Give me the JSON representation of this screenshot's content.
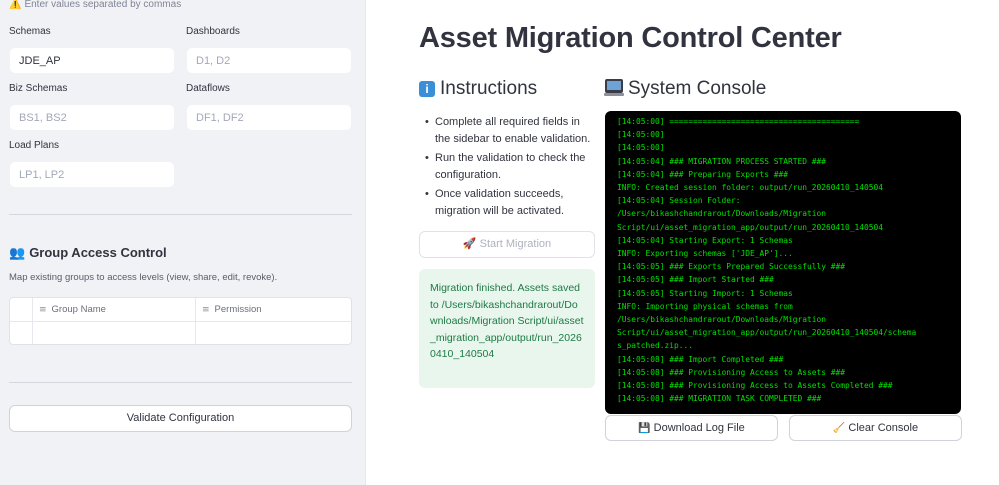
{
  "sidebar": {
    "hint": "Enter values separated by commas",
    "fields": {
      "schemas": {
        "label": "Schemas",
        "value": "JDE_AP",
        "placeholder": ""
      },
      "dashboards": {
        "label": "Dashboards",
        "value": "",
        "placeholder": "D1, D2"
      },
      "biz_schemas": {
        "label": "Biz Schemas",
        "value": "",
        "placeholder": "BS1, BS2"
      },
      "dataflows": {
        "label": "Dataflows",
        "value": "",
        "placeholder": "DF1, DF2"
      },
      "load_plans": {
        "label": "Load Plans",
        "value": "",
        "placeholder": "LP1, LP2"
      }
    },
    "group_access": {
      "title": "Group Access Control",
      "subtitle": "Map existing groups to access levels (view, share, edit, revoke).",
      "columns": [
        "Group Name",
        "Permission"
      ]
    },
    "validate_button": "Validate Configuration"
  },
  "main": {
    "title": "Asset Migration Control Center",
    "instructions": {
      "heading": "Instructions",
      "steps": [
        "Complete all required fields in the sidebar to enable validation.",
        "Run the validation to check the configuration.",
        "Once validation succeeds, migration will be activated."
      ]
    },
    "start_button": "Start Migration",
    "success_message": "Migration finished. Assets saved to /Users/bikashchandrarout/Downloads/Migration Script/ui/asset_migration_app/output/run_20260410_140504",
    "console": {
      "heading": "System Console",
      "lines": [
        "[14:05:00] ========================================",
        "[14:05:00]",
        "[14:05:00]",
        "[14:05:04] ### MIGRATION PROCESS STARTED ###",
        "[14:05:04] ### Preparing Exports ###",
        "INFO: Created session folder: output/run_20260410_140504",
        "[14:05:04] Session Folder:",
        "/Users/bikashchandrarout/Downloads/Migration",
        "Script/ui/asset_migration_app/output/run_20260410_140504",
        "[14:05:04] Starting Export: 1 Schemas",
        "INFO: Exporting schemas ['JDE_AP']...",
        "[14:05:05] ### Exports Prepared Successfully ###",
        "[14:05:05] ### Import Started ###",
        "[14:05:05] Starting Import: 1 Schemas",
        "INFO: Importing physical schemas from",
        "/Users/bikashchandrarout/Downloads/Migration",
        "Script/ui/asset_migration_app/output/run_20260410_140504/schema",
        "s_patched.zip...",
        "[14:05:08] ### Import Completed ###",
        "[14:05:08] ### Provisioning Access to Assets ###",
        "[14:05:08] ### Provisioning Access to Assets Completed ###",
        "[14:05:08] ### MIGRATION TASK COMPLETED ###"
      ],
      "download_button": "Download Log File",
      "clear_button": "Clear Console"
    }
  },
  "icons": {
    "warning": "warning-icon",
    "group": "people-icon",
    "info": "info-icon",
    "computer": "laptop-icon",
    "rocket": "rocket-icon",
    "floppy": "floppy-disk-icon",
    "broom": "broom-icon",
    "column": "column-sort-icon"
  },
  "colors": {
    "sidebar_bg": "#f0f2f6",
    "success_bg": "#e8f6ed",
    "success_text": "#1e7a45",
    "console_bg": "#000000",
    "console_text": "#00e000"
  }
}
